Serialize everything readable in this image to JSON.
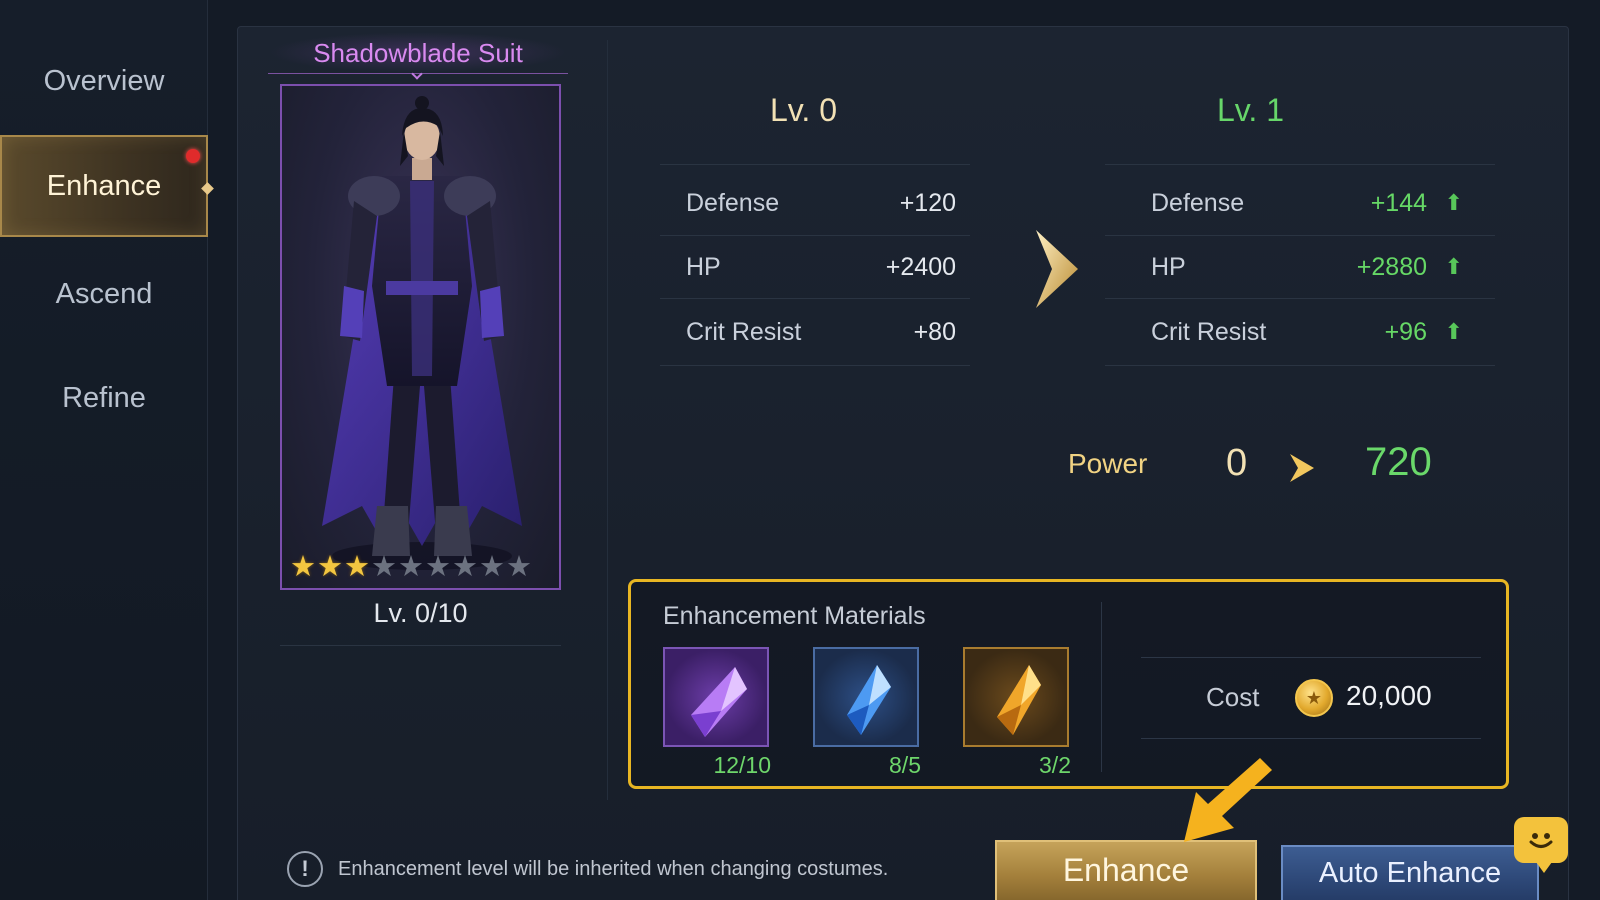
{
  "sidebar": {
    "items": [
      {
        "label": "Overview"
      },
      {
        "label": "Enhance"
      },
      {
        "label": "Ascend"
      },
      {
        "label": "Refine"
      }
    ],
    "active": "Enhance"
  },
  "costume": {
    "name": "Shadowblade Suit",
    "level": "Lv. 0/10",
    "stars_filled": 3,
    "stars_total": 9
  },
  "levels": {
    "current": "Lv. 0",
    "next": "Lv. 1"
  },
  "stats": {
    "current": [
      {
        "name": "Defense",
        "value": "+120"
      },
      {
        "name": "HP",
        "value": "+2400"
      },
      {
        "name": "Crit Resist",
        "value": "+80"
      }
    ],
    "next": [
      {
        "name": "Defense",
        "value": "+144"
      },
      {
        "name": "HP",
        "value": "+2880"
      },
      {
        "name": "Crit Resist",
        "value": "+96"
      }
    ]
  },
  "power": {
    "label": "Power",
    "current": "0",
    "next": "720"
  },
  "materials": {
    "title": "Enhancement Materials",
    "items": [
      {
        "icon": "purple-crystal-icon",
        "count": "12/10"
      },
      {
        "icon": "blue-crystal-icon",
        "count": "8/5"
      },
      {
        "icon": "gold-crystal-icon",
        "count": "3/2"
      }
    ],
    "cost_label": "Cost",
    "cost_value": "20,000",
    "cost_icon": "gold-coin-icon"
  },
  "notice": "Enhancement level will be inherited when changing costumes.",
  "buttons": {
    "enhance": "Enhance",
    "auto_enhance": "Auto Enhance"
  },
  "colors": {
    "accent_gold": "#e8b623",
    "increase_green": "#66d866",
    "costume_name_purple": "#d98af0",
    "notification_red": "#e02b2b"
  }
}
